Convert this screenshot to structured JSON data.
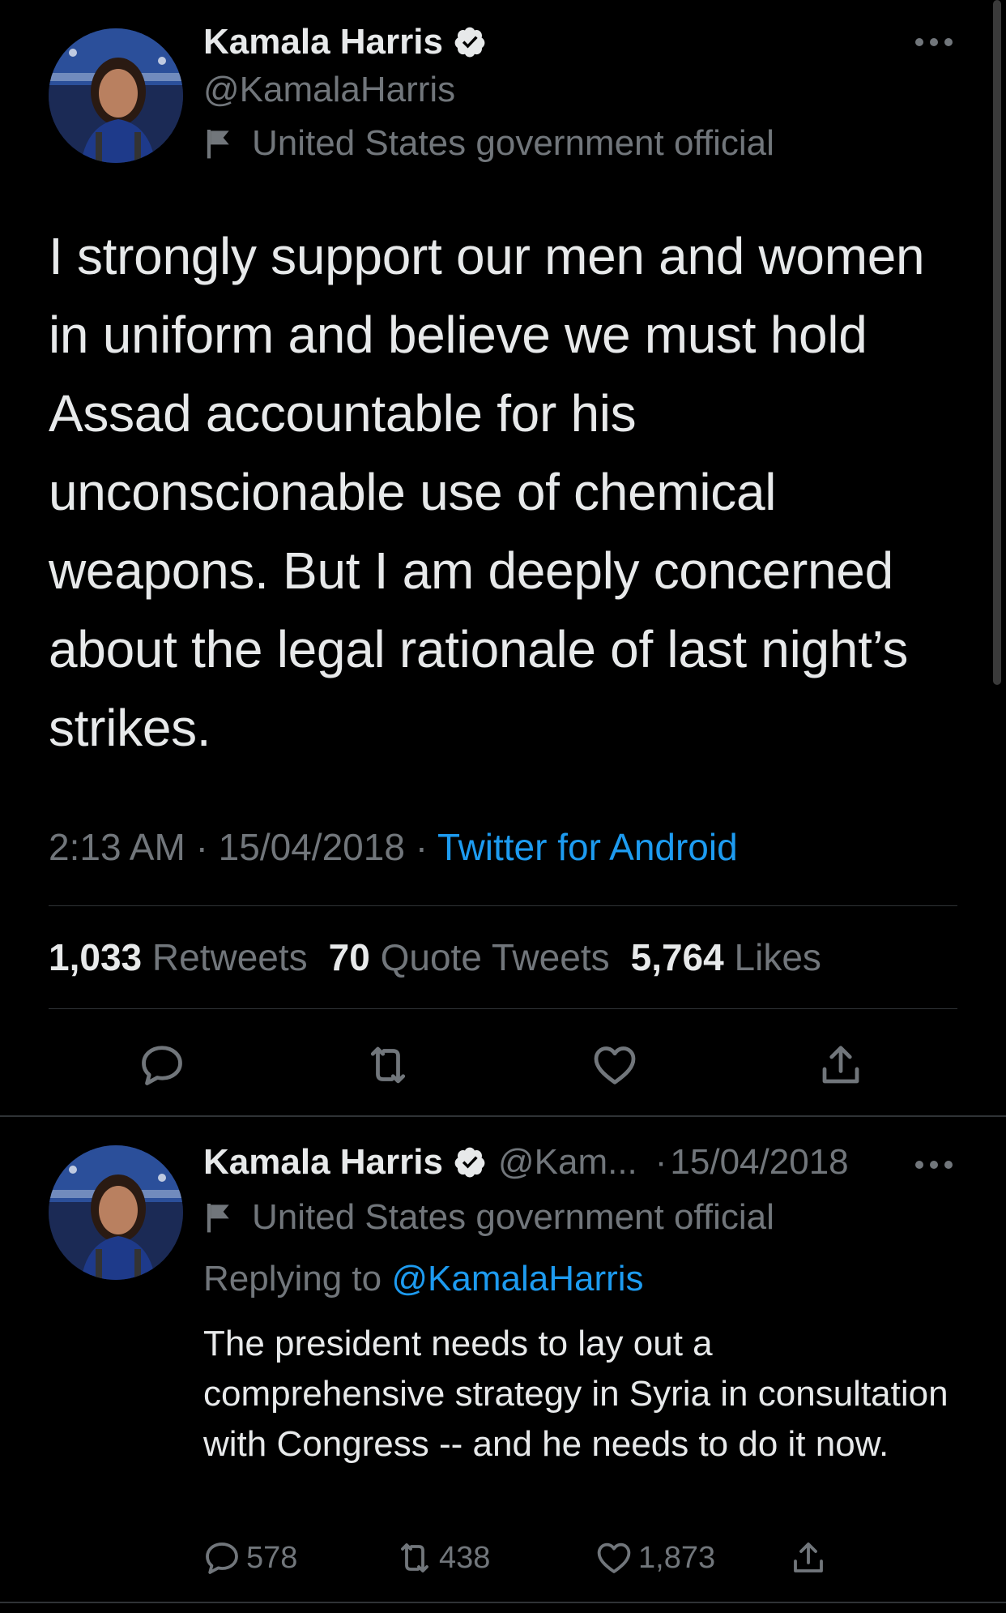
{
  "colors": {
    "background": "#000000",
    "text_primary": "#e7e9ea",
    "text_secondary": "#71767b",
    "link": "#1d9bf0",
    "divider": "#2f3336"
  },
  "main_tweet": {
    "author": {
      "name": "Kamala Harris",
      "handle": "@KamalaHarris",
      "verified": true,
      "label": "United States government official"
    },
    "text": "I strongly support our men and women in uniform and believe we must hold Assad accountable for his unconscionable use of chemical weapons. But I am deeply concerned about the legal rationale of last night’s strikes.",
    "time": "2:13 AM",
    "separator": "·",
    "date": "15/04/2018",
    "source": "Twitter for Android",
    "stats": {
      "retweets_count": "1,033",
      "retweets_label": "Retweets",
      "quotes_count": "70",
      "quotes_label": "Quote Tweets",
      "likes_count": "5,764",
      "likes_label": "Likes"
    },
    "actions": [
      "reply-icon",
      "retweet-icon",
      "like-icon",
      "share-icon"
    ]
  },
  "reply_tweet": {
    "author": {
      "name": "Kamala Harris",
      "handle_truncated": "@Kam...",
      "verified": true,
      "label": "United States government official"
    },
    "separator": "·",
    "date": "15/04/2018",
    "replying_prefix": "Replying to",
    "replying_to": "@KamalaHarris",
    "text": "The president needs to lay out a comprehensive strategy in Syria in consultation with Congress -- and he needs to do it now.",
    "counts": {
      "replies": "578",
      "retweets": "438",
      "likes": "1,873"
    }
  }
}
